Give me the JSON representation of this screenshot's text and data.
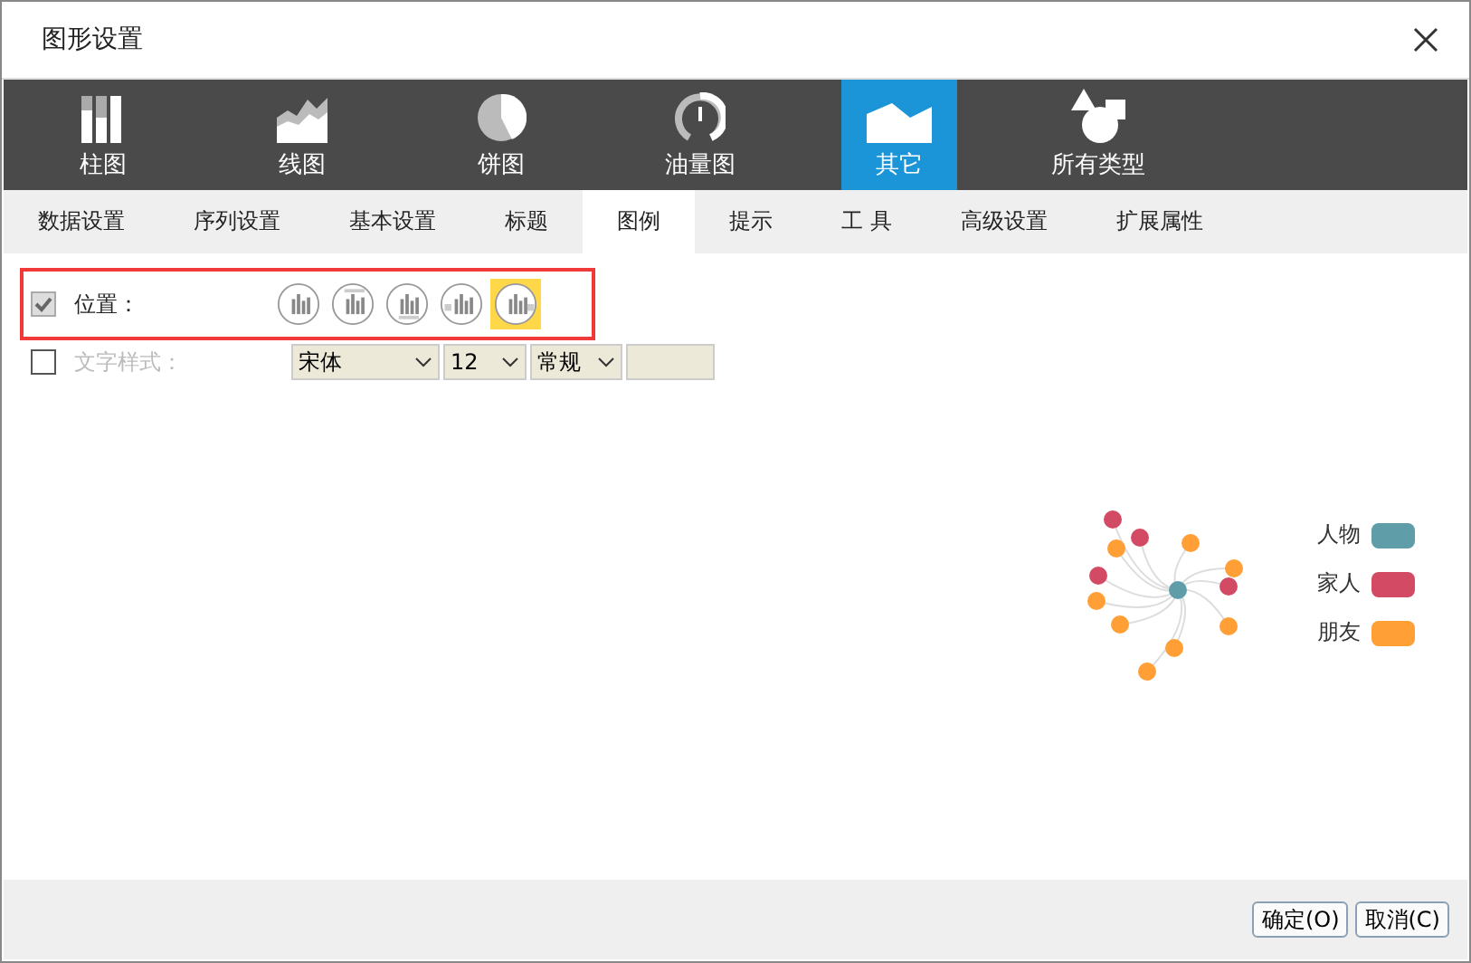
{
  "window": {
    "title": "图形设置"
  },
  "chart_types": [
    {
      "label": "柱图",
      "kind": "bar",
      "selected": false
    },
    {
      "label": "线图",
      "kind": "line",
      "selected": false
    },
    {
      "label": "饼图",
      "kind": "pie",
      "selected": false
    },
    {
      "label": "油量图",
      "kind": "gauge",
      "selected": false
    },
    {
      "label": "其它",
      "kind": "other",
      "selected": true
    },
    {
      "label": "所有类型",
      "kind": "all",
      "selected": false
    }
  ],
  "tabs": [
    {
      "label": "数据设置",
      "selected": false
    },
    {
      "label": "序列设置",
      "selected": false
    },
    {
      "label": "基本设置",
      "selected": false
    },
    {
      "label": "标题",
      "selected": false
    },
    {
      "label": "图例",
      "selected": true
    },
    {
      "label": "提示",
      "selected": false
    },
    {
      "label": "工 具",
      "selected": false
    },
    {
      "label": "高级设置",
      "selected": false
    },
    {
      "label": "扩展属性",
      "selected": false
    }
  ],
  "position": {
    "label": "位置：",
    "checked": true,
    "options": [
      {
        "selected": false
      },
      {
        "selected": false
      },
      {
        "selected": false
      },
      {
        "selected": false
      },
      {
        "selected": true
      }
    ]
  },
  "text_style": {
    "label": "文字样式：",
    "checked": false,
    "font": "宋体",
    "size": "12",
    "weight": "常规"
  },
  "legend": [
    {
      "name": "人物",
      "color": "#5f9ea8"
    },
    {
      "name": "家人",
      "color": "#d34a64"
    },
    {
      "name": "朋友",
      "color": "#ff9f35"
    }
  ],
  "buttons": [
    "确定(O)",
    "取消(C)"
  ]
}
